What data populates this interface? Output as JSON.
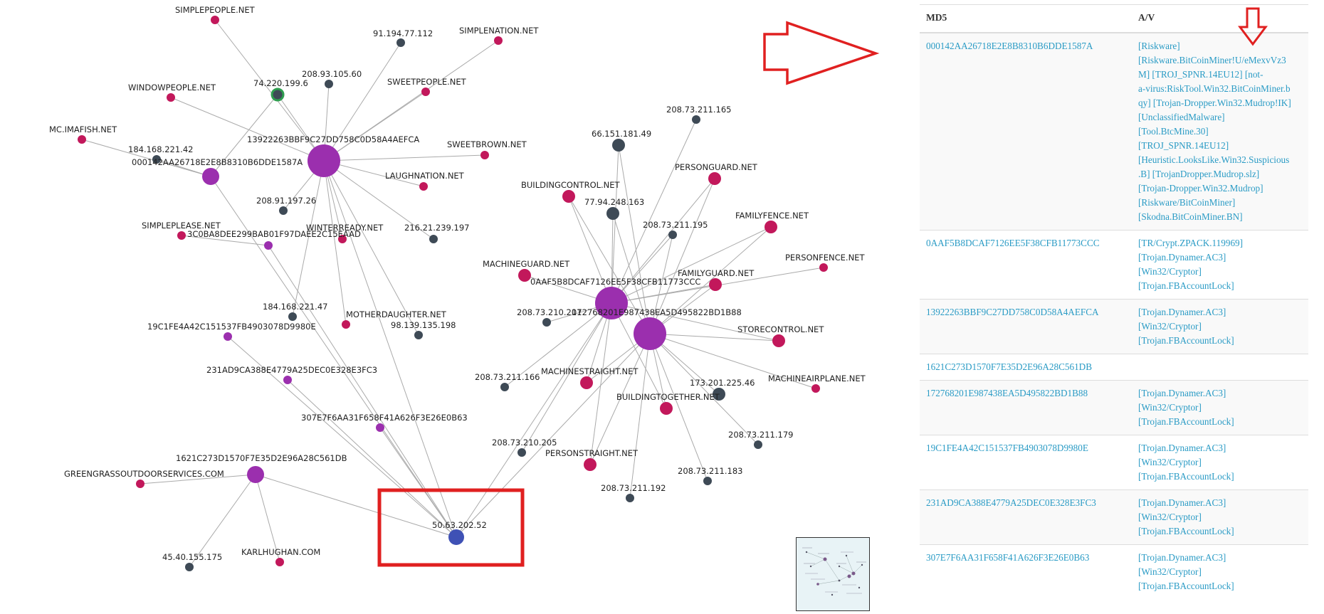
{
  "colors": {
    "hash_node": "#9b2fae",
    "domain_node": "#c2185b",
    "ip_node": "#3e4a56",
    "highlight_ip": "#3f51b5",
    "green_ring": "#2e9e4f",
    "edge": "#aaaaaa",
    "annotation_red": "#e02020",
    "link": "#2a9bc5"
  },
  "graph": {
    "nodes": [
      {
        "id": "n1",
        "label": "SIMPLEPEOPLE.NET",
        "type": "domain"
      },
      {
        "id": "n2",
        "label": "91.194.77.112",
        "type": "ip"
      },
      {
        "id": "n3",
        "label": "SIMPLENATION.NET",
        "type": "domain"
      },
      {
        "id": "n4",
        "label": "208.93.105.60",
        "type": "ip"
      },
      {
        "id": "n5",
        "label": "74.220.199.6",
        "type": "ip_green"
      },
      {
        "id": "n6",
        "label": "WINDOWPEOPLE.NET",
        "type": "domain"
      },
      {
        "id": "n7",
        "label": "SWEETPEOPLE.NET",
        "type": "domain"
      },
      {
        "id": "n8",
        "label": "MC.IMAFISH.NET",
        "type": "domain"
      },
      {
        "id": "n9",
        "label": "184.168.221.42",
        "type": "ip"
      },
      {
        "id": "n10",
        "label": "13922263BBF9C27DD758C0D58A4AEFCA",
        "type": "hash_large"
      },
      {
        "id": "n11",
        "label": "SWEETBROWN.NET",
        "type": "domain"
      },
      {
        "id": "n12",
        "label": "000142AA26718E2E8B8310B6DDE1587A",
        "type": "hash"
      },
      {
        "id": "n13",
        "label": "LAUGHNATION.NET",
        "type": "domain"
      },
      {
        "id": "n14",
        "label": "208.91.197.26",
        "type": "ip"
      },
      {
        "id": "n15",
        "label": "SIMPLEPLEASE.NET",
        "type": "domain"
      },
      {
        "id": "n16",
        "label": "WINTERREADY.NET",
        "type": "domain"
      },
      {
        "id": "n17",
        "label": "3C0BA8DEE299BAB01F97DAEE2C15EAAD",
        "type": "hash_small"
      },
      {
        "id": "n18",
        "label": "216.21.239.197",
        "type": "ip"
      },
      {
        "id": "n19",
        "label": "184.168.221.47",
        "type": "ip"
      },
      {
        "id": "n20",
        "label": "MOTHERDAUGHTER.NET",
        "type": "domain"
      },
      {
        "id": "n21",
        "label": "98.139.135.198",
        "type": "ip"
      },
      {
        "id": "n22",
        "label": "19C1FE4A42C151537FB4903078D9980E",
        "type": "hash_small"
      },
      {
        "id": "n23",
        "label": "231AD9CA388E4779A25DEC0E328E3FC3",
        "type": "hash_small"
      },
      {
        "id": "n24",
        "label": "307E7F6AA31F658F41A626F3E26E0B63",
        "type": "hash_small"
      },
      {
        "id": "n25",
        "label": "1621C273D1570F7E35D2E96A28C561DB",
        "type": "hash"
      },
      {
        "id": "n26",
        "label": "GREENGRASSOUTDOORSERVICES.COM",
        "type": "domain"
      },
      {
        "id": "n27",
        "label": "45.40.155.175",
        "type": "ip"
      },
      {
        "id": "n28",
        "label": "KARLHUGHAN.COM",
        "type": "domain"
      },
      {
        "id": "n29",
        "label": "50.63.202.52",
        "type": "ip_highlight"
      },
      {
        "id": "n30",
        "label": "208.73.211.165",
        "type": "ip"
      },
      {
        "id": "n31",
        "label": "66.151.181.49",
        "type": "ip_medium"
      },
      {
        "id": "n32",
        "label": "BUILDINGCONTROL.NET",
        "type": "domain_medium"
      },
      {
        "id": "n33",
        "label": "77.94.248.163",
        "type": "ip_medium"
      },
      {
        "id": "n34",
        "label": "PERSONGUARD.NET",
        "type": "domain_medium"
      },
      {
        "id": "n35",
        "label": "208.73.211.195",
        "type": "ip"
      },
      {
        "id": "n36",
        "label": "FAMILYFENCE.NET",
        "type": "domain_medium"
      },
      {
        "id": "n37",
        "label": "MACHINEGUARD.NET",
        "type": "domain_medium"
      },
      {
        "id": "n38",
        "label": "PERSONFENCE.NET",
        "type": "domain"
      },
      {
        "id": "n39",
        "label": "0AAF5B8DCAF7126EE5F38CFB11773CCC",
        "type": "hash_large"
      },
      {
        "id": "n40",
        "label": "FAMILYGUARD.NET",
        "type": "domain_medium"
      },
      {
        "id": "n41",
        "label": "208.73.210.201",
        "type": "ip"
      },
      {
        "id": "n42",
        "label": "172768201E987438EA5D495822BD1B88",
        "type": "hash_large"
      },
      {
        "id": "n43",
        "label": "STORECONTROL.NET",
        "type": "domain_medium"
      },
      {
        "id": "n44",
        "label": "208.73.211.166",
        "type": "ip"
      },
      {
        "id": "n45",
        "label": "MACHINESTRAIGHT.NET",
        "type": "domain_medium"
      },
      {
        "id": "n46",
        "label": "173.201.225.46",
        "type": "ip_medium"
      },
      {
        "id": "n47",
        "label": "MACHINEAIRPLANE.NET",
        "type": "domain"
      },
      {
        "id": "n48",
        "label": "BUILDINGTOGETHER.NET",
        "type": "domain_medium"
      },
      {
        "id": "n49",
        "label": "208.73.211.179",
        "type": "ip"
      },
      {
        "id": "n50",
        "label": "208.73.210.205",
        "type": "ip"
      },
      {
        "id": "n51",
        "label": "PERSONSTRAIGHT.NET",
        "type": "domain_medium"
      },
      {
        "id": "n52",
        "label": "208.73.211.183",
        "type": "ip"
      },
      {
        "id": "n53",
        "label": "208.73.211.192",
        "type": "ip"
      }
    ],
    "edges": [
      [
        "n10",
        "n1"
      ],
      [
        "n10",
        "n2"
      ],
      [
        "n10",
        "n3"
      ],
      [
        "n10",
        "n4"
      ],
      [
        "n10",
        "n5"
      ],
      [
        "n10",
        "n6"
      ],
      [
        "n10",
        "n7"
      ],
      [
        "n10",
        "n11"
      ],
      [
        "n10",
        "n13"
      ],
      [
        "n10",
        "n14"
      ],
      [
        "n10",
        "n16"
      ],
      [
        "n10",
        "n18"
      ],
      [
        "n10",
        "n19"
      ],
      [
        "n10",
        "n20"
      ],
      [
        "n10",
        "n21"
      ],
      [
        "n10",
        "n29"
      ],
      [
        "n12",
        "n8"
      ],
      [
        "n12",
        "n9"
      ],
      [
        "n12",
        "n29"
      ],
      [
        "n12",
        "n5"
      ],
      [
        "n17",
        "n15"
      ],
      [
        "n17",
        "n29"
      ],
      [
        "n22",
        "n29"
      ],
      [
        "n23",
        "n29"
      ],
      [
        "n24",
        "n29"
      ],
      [
        "n25",
        "n26"
      ],
      [
        "n25",
        "n27"
      ],
      [
        "n25",
        "n28"
      ],
      [
        "n25",
        "n29"
      ],
      [
        "n39",
        "n30"
      ],
      [
        "n39",
        "n31"
      ],
      [
        "n39",
        "n32"
      ],
      [
        "n39",
        "n33"
      ],
      [
        "n39",
        "n34"
      ],
      [
        "n39",
        "n35"
      ],
      [
        "n39",
        "n36"
      ],
      [
        "n39",
        "n37"
      ],
      [
        "n39",
        "n38"
      ],
      [
        "n39",
        "n40"
      ],
      [
        "n39",
        "n41"
      ],
      [
        "n39",
        "n43"
      ],
      [
        "n39",
        "n44"
      ],
      [
        "n39",
        "n45"
      ],
      [
        "n39",
        "n48"
      ],
      [
        "n39",
        "n50"
      ],
      [
        "n39",
        "n51"
      ],
      [
        "n39",
        "n29"
      ],
      [
        "n42",
        "n31"
      ],
      [
        "n42",
        "n33"
      ],
      [
        "n42",
        "n34"
      ],
      [
        "n42",
        "n35"
      ],
      [
        "n42",
        "n36"
      ],
      [
        "n42",
        "n40"
      ],
      [
        "n42",
        "n43"
      ],
      [
        "n42",
        "n45"
      ],
      [
        "n42",
        "n46"
      ],
      [
        "n42",
        "n47"
      ],
      [
        "n42",
        "n48"
      ],
      [
        "n42",
        "n49"
      ],
      [
        "n42",
        "n51"
      ],
      [
        "n42",
        "n52"
      ],
      [
        "n42",
        "n53"
      ],
      [
        "n42",
        "n29"
      ],
      [
        "n42",
        "n32"
      ]
    ]
  },
  "table": {
    "headers": {
      "md5": "MD5",
      "av": "A/V"
    },
    "rows": [
      {
        "md5": "000142AA26718E2E8B8310B6DDE1587A",
        "av": [
          "[Riskware]",
          "[Riskware.BitCoinMiner!U/eMexvVz3",
          "M] [TROJ_SPNR.14EU12] [not-",
          "a-virus:RiskTool.Win32.BitCoinMiner.b",
          "qy] [Trojan-Dropper.Win32.Mudrop!IK]",
          "[UnclassifiedMalware]",
          "[Tool.BtcMine.30]",
          "[TROJ_SPNR.14EU12]",
          "[Heuristic.LooksLike.Win32.Suspicious",
          ".B] [TrojanDropper.Mudrop.slz]",
          "[Trojan-Dropper.Win32.Mudrop]",
          "[Riskware/BitCoinMiner]",
          "[Skodna.BitCoinMiner.BN]"
        ]
      },
      {
        "md5": "0AAF5B8DCAF7126EE5F38CFB11773CCC",
        "av": [
          "[TR/Crypt.ZPACK.119969]",
          "[Trojan.Dynamer.AC3]",
          "[Win32/Cryptor]",
          "[Trojan.FBAccountLock]"
        ]
      },
      {
        "md5": "13922263BBF9C27DD758C0D58A4AEFCA",
        "av": [
          "[Trojan.Dynamer.AC3]",
          "[Win32/Cryptor]",
          "[Trojan.FBAccountLock]"
        ]
      },
      {
        "md5": "1621C273D1570F7E35D2E96A28C561DB",
        "av": []
      },
      {
        "md5": "172768201E987438EA5D495822BD1B88",
        "av": [
          "[Trojan.Dynamer.AC3]",
          "[Win32/Cryptor]",
          "[Trojan.FBAccountLock]"
        ]
      },
      {
        "md5": "19C1FE4A42C151537FB4903078D9980E",
        "av": [
          "[Trojan.Dynamer.AC3]",
          "[Win32/Cryptor]",
          "[Trojan.FBAccountLock]"
        ]
      },
      {
        "md5": "231AD9CA388E4779A25DEC0E328E3FC3",
        "av": [
          "[Trojan.Dynamer.AC3]",
          "[Win32/Cryptor]",
          "[Trojan.FBAccountLock]"
        ]
      },
      {
        "md5": "307E7F6AA31F658F41A626F3E26E0B63",
        "av": [
          "[Trojan.Dynamer.AC3]",
          "[Win32/Cryptor]",
          "[Trojan.FBAccountLock]"
        ]
      }
    ]
  }
}
